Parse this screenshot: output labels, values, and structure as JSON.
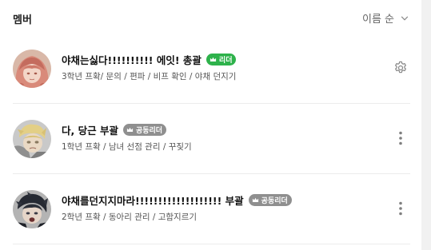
{
  "header": {
    "title": "멤버",
    "sort_label": "이름 순"
  },
  "colors": {
    "leader_badge": "#2eb24b",
    "coleader_badge": "#8f8f8f",
    "icon_gray": "#8a8a8a"
  },
  "members": [
    {
      "name": "야채는싫다!!!!!!!!!! 에잇! 총괄",
      "badge": "리더",
      "badge_type": "leader",
      "description": "3학년 프확/ 문의 / 편파 / 비프 확인 / 야채 던지기",
      "action_icon": "gear-icon"
    },
    {
      "name": "다, 당근 부괄",
      "badge": "공동리더",
      "badge_type": "coleader",
      "description": "1학년 프확 / 남녀 선점 관리 / 꾸짖기",
      "action_icon": "more-vertical-icon"
    },
    {
      "name": "야채를던지지마라!!!!!!!!!!!!!!!!!!! 부괄",
      "badge": "공동리더",
      "badge_type": "coleader",
      "description": "2학년 프확 / 동아리 관리 / 고함지르기",
      "action_icon": "more-vertical-icon"
    }
  ]
}
